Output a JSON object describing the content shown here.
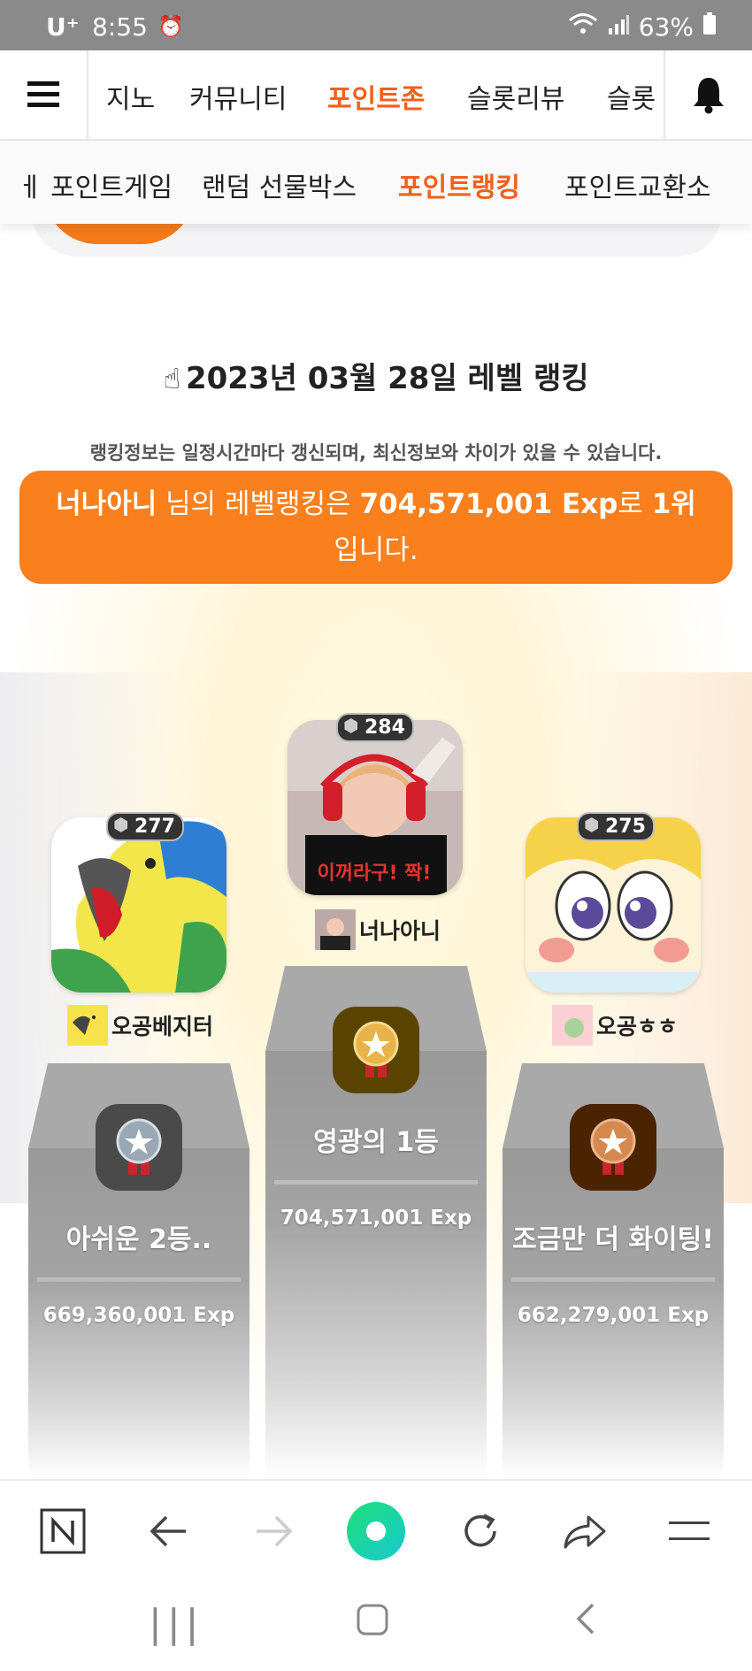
{
  "status_bar": {
    "carrier": "U⁺",
    "time": "8:55",
    "battery": "63%"
  },
  "top_nav": {
    "items": [
      "지노",
      "커뮤니티",
      "포인트존",
      "슬롯리뷰",
      "슬롯"
    ],
    "active": "포인트존"
  },
  "sub_nav": {
    "items": [
      "포인트게임",
      "랜덤 선물박스",
      "포인트랭킹",
      "포인트교환소"
    ],
    "active": "포인트랭킹"
  },
  "ranking": {
    "title": "2023년 03월 28일 레벨 랭킹",
    "notice": "랭킹정보는 일정시간마다 갱신되며, 최신정보와 차이가 있을 수 있습니다.",
    "banner": {
      "user": "너나아니",
      "suffix_1": "님의 레벨랭킹은",
      "exp": "704,571,001 Exp",
      "suffix_2": "로",
      "rank": "1위",
      "suffix_3": "입니다."
    }
  },
  "podium": {
    "first": {
      "level": "284",
      "nickname": "너나아니",
      "title": "영광의 1등",
      "exp": "704,571,001 Exp"
    },
    "second": {
      "level": "277",
      "nickname": "오공베지터",
      "title": "아쉬운 2등..",
      "exp": "669,360,001 Exp"
    },
    "third": {
      "level": "275",
      "nickname": "오공ㅎㅎ",
      "title": "조금만 더 화이팅!",
      "exp": "662,279,001 Exp"
    }
  },
  "colors": {
    "accent": "#f2601d",
    "banner": "#fa7f1d",
    "podium": "#a4a4a4"
  }
}
